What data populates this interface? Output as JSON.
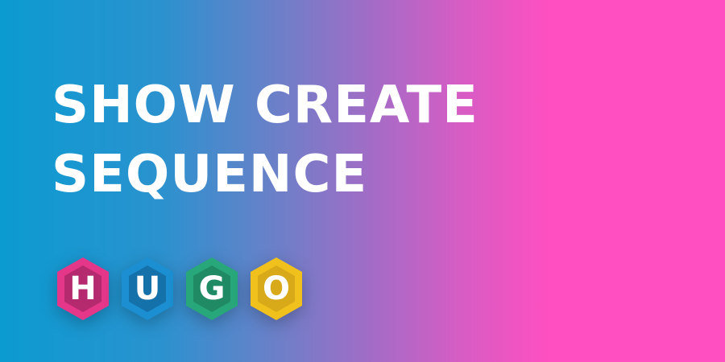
{
  "title": {
    "line1": "SHOW CREATE",
    "line2": "SEQUENCE"
  },
  "logo": {
    "letters": [
      {
        "char": "H",
        "color": "#e4378a",
        "inner": "#b5296f"
      },
      {
        "char": "U",
        "color": "#1b8fd1",
        "inner": "#1571aa"
      },
      {
        "char": "G",
        "color": "#27a77a",
        "inner": "#1f8a63"
      },
      {
        "char": "O",
        "color": "#f0c11c",
        "inner": "#d8a918"
      }
    ]
  }
}
